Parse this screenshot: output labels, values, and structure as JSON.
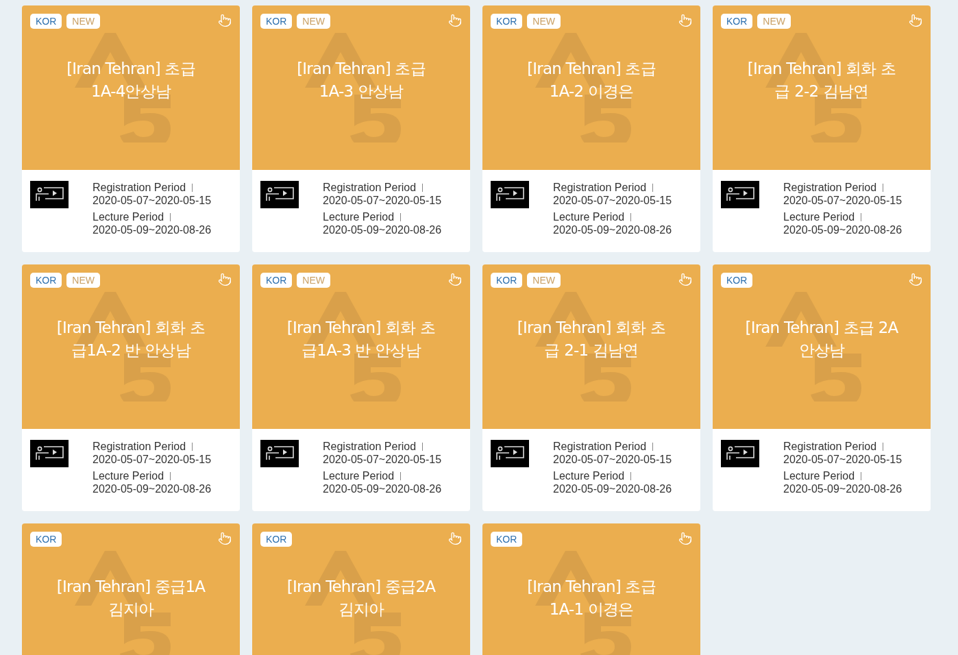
{
  "courses": [
    {
      "tags": [
        {
          "label": "KOR",
          "kind": "language"
        },
        {
          "label": "NEW",
          "kind": "new"
        }
      ],
      "title": [
        "[Iran Tehran] 초급",
        "1A-4안상남"
      ],
      "registration": {
        "label": "Registration Period",
        "dates": "2020-05-07~2020-05-15"
      },
      "lecture": {
        "label": "Lecture Period",
        "dates": "2020-05-09~2020-08-26"
      }
    },
    {
      "tags": [
        {
          "label": "KOR",
          "kind": "language"
        },
        {
          "label": "NEW",
          "kind": "new"
        }
      ],
      "title": [
        "[Iran Tehran] 초급",
        "1A-3 안상남"
      ],
      "registration": {
        "label": "Registration Period",
        "dates": "2020-05-07~2020-05-15"
      },
      "lecture": {
        "label": "Lecture Period",
        "dates": "2020-05-09~2020-08-26"
      }
    },
    {
      "tags": [
        {
          "label": "KOR",
          "kind": "language"
        },
        {
          "label": "NEW",
          "kind": "new"
        }
      ],
      "title": [
        "[Iran Tehran] 초급",
        "1A-2 이경은"
      ],
      "registration": {
        "label": "Registration Period",
        "dates": "2020-05-07~2020-05-15"
      },
      "lecture": {
        "label": "Lecture Period",
        "dates": "2020-05-09~2020-08-26"
      }
    },
    {
      "tags": [
        {
          "label": "KOR",
          "kind": "language"
        },
        {
          "label": "NEW",
          "kind": "new"
        }
      ],
      "title": [
        "[Iran Tehran] 회화 초",
        "급 2-2 김남연"
      ],
      "registration": {
        "label": "Registration Period",
        "dates": "2020-05-07~2020-05-15"
      },
      "lecture": {
        "label": "Lecture Period",
        "dates": "2020-05-09~2020-08-26"
      }
    },
    {
      "tags": [
        {
          "label": "KOR",
          "kind": "language"
        },
        {
          "label": "NEW",
          "kind": "new"
        }
      ],
      "title": [
        "[Iran Tehran] 회화 초",
        "급1A-2 반 안상남"
      ],
      "registration": {
        "label": "Registration Period",
        "dates": "2020-05-07~2020-05-15"
      },
      "lecture": {
        "label": "Lecture Period",
        "dates": "2020-05-09~2020-08-26"
      }
    },
    {
      "tags": [
        {
          "label": "KOR",
          "kind": "language"
        },
        {
          "label": "NEW",
          "kind": "new"
        }
      ],
      "title": [
        "[Iran Tehran] 회화 초",
        "급1A-3 반 안상남"
      ],
      "registration": {
        "label": "Registration Period",
        "dates": "2020-05-07~2020-05-15"
      },
      "lecture": {
        "label": "Lecture Period",
        "dates": "2020-05-09~2020-08-26"
      }
    },
    {
      "tags": [
        {
          "label": "KOR",
          "kind": "language"
        },
        {
          "label": "NEW",
          "kind": "new"
        }
      ],
      "title": [
        "[Iran Tehran] 회화 초",
        "급 2-1 김남연"
      ],
      "registration": {
        "label": "Registration Period",
        "dates": "2020-05-07~2020-05-15"
      },
      "lecture": {
        "label": "Lecture Period",
        "dates": "2020-05-09~2020-08-26"
      }
    },
    {
      "tags": [
        {
          "label": "KOR",
          "kind": "language"
        }
      ],
      "title": [
        "[Iran Tehran] 초급 2A",
        "안상남"
      ],
      "registration": {
        "label": "Registration Period",
        "dates": "2020-05-07~2020-05-15"
      },
      "lecture": {
        "label": "Lecture Period",
        "dates": "2020-05-09~2020-08-26"
      }
    },
    {
      "tags": [
        {
          "label": "KOR",
          "kind": "language"
        }
      ],
      "title": [
        "[Iran Tehran] 중급1A",
        "김지아"
      ]
    },
    {
      "tags": [
        {
          "label": "KOR",
          "kind": "language"
        }
      ],
      "title": [
        "[Iran Tehran] 중급2A",
        "김지아"
      ]
    },
    {
      "tags": [
        {
          "label": "KOR",
          "kind": "language"
        }
      ],
      "title": [
        "[Iran Tehran] 초급",
        "1A-1 이경은"
      ]
    }
  ]
}
